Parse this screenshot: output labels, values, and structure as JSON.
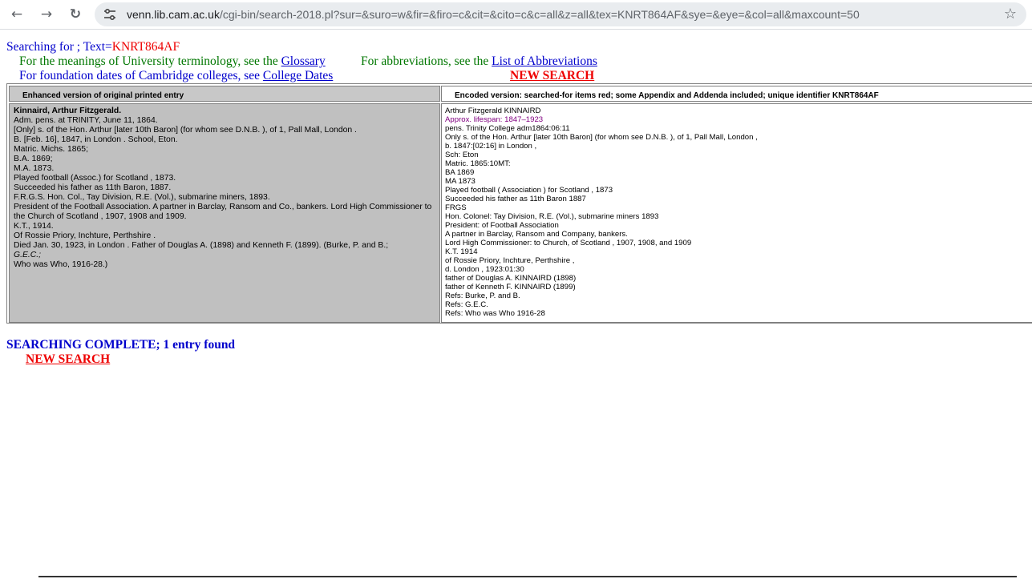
{
  "browser": {
    "url_domain": "venn.lib.cam.ac.uk",
    "url_path": "/cgi-bin/search-2018.pl?sur=&suro=w&fir=&firo=c&cit=&cito=c&c=all&z=all&tex=KNRT864AF&sye=&eye=&col=all&maxcount=50",
    "back_icon": "←",
    "forward_icon": "→",
    "reload_icon": "↻",
    "star_icon": "☆"
  },
  "header": {
    "searching_for": "Searching for ; Text=",
    "search_term": "KNRT864AF",
    "meanings_text": "For the meanings of University terminology, see the ",
    "glossary_link": "Glossary",
    "abbrev_text": "For abbreviations, see the ",
    "abbrev_link": "List of Abbreviations",
    "dates_text": "For foundation dates of Cambridge colleges, see ",
    "dates_link": "College Dates",
    "new_search": "NEW SEARCH"
  },
  "table": {
    "left_header": "Enhanced version of original printed entry",
    "right_header": "Encoded version: searched-for items red; some Appendix and Addenda included; unique identifier KNRT864AF",
    "left_name": "Kinnaird, Arthur Fitzgerald.",
    "left_lines": [
      "Adm. pens. at TRINITY, June 11, 1864.",
      "[Only] s. of the Hon. Arthur [later 10th Baron] (for whom see D.N.B. ), of 1, Pall Mall, London .",
      "B. [Feb. 16], 1847, in London . School, Eton.",
      "Matric. Michs. 1865;",
      "B.A. 1869;",
      "M.A. 1873.",
      "Played football (Assoc.) for Scotland , 1873.",
      "Succeeded his father as 11th Baron, 1887.",
      "F.R.G.S. Hon. Col., Tay Division, R.E. (Vol.), submarine miners, 1893.",
      "President of the Football Association. A partner in Barclay, Ransom and Co., bankers. Lord High Commissioner to the Church of Scotland , 1907, 1908 and 1909.",
      "K.T., 1914.",
      "Of Rossie Priory, Inchture, Perthshire .",
      "Died Jan. 30, 1923, in London . Father of Douglas A. (1898) and Kenneth F. (1899). (Burke, P. and B.;",
      "G.E.C.;",
      "Who was Who, 1916-28.)"
    ],
    "right_lines": [
      "Arthur Fitzgerald KINNAIRD",
      "Approx. lifespan: 1847–1923",
      "pens. Trinity College adm1864:06:11",
      "Only s. of the Hon. Arthur [later 10th Baron] (for whom see D.N.B. ), of 1, Pall Mall, London ,",
      "b. 1847:[02:16] in London ,",
      "Sch: Eton",
      "Matric. 1865:10MT:",
      "BA 1869",
      "MA 1873",
      "Played football ( Association ) for Scotland , 1873",
      "Succeeded his father as 11th Baron 1887",
      "FRGS",
      "Hon. Colonel: Tay Division, R.E. (Vol.), submarine miners 1893",
      "President: of Football Association",
      "A partner in Barclay, Ransom and Company, bankers.",
      "Lord High Commissioner: to Church, of Scotland , 1907, 1908, and 1909",
      "K.T. 1914",
      "of Rossie Priory, Inchture, Perthshire ,",
      "d. London , 1923:01:30",
      "father of Douglas A. KINNAIRD (1898)",
      "father of Kenneth F. KINNAIRD (1899)",
      "Refs: Burke, P. and B.",
      "Refs: G.E.C.",
      "Refs: Who was Who 1916-28"
    ]
  },
  "footer": {
    "complete": "SEARCHING COMPLETE; 1 entry found",
    "new_search": "NEW SEARCH"
  }
}
